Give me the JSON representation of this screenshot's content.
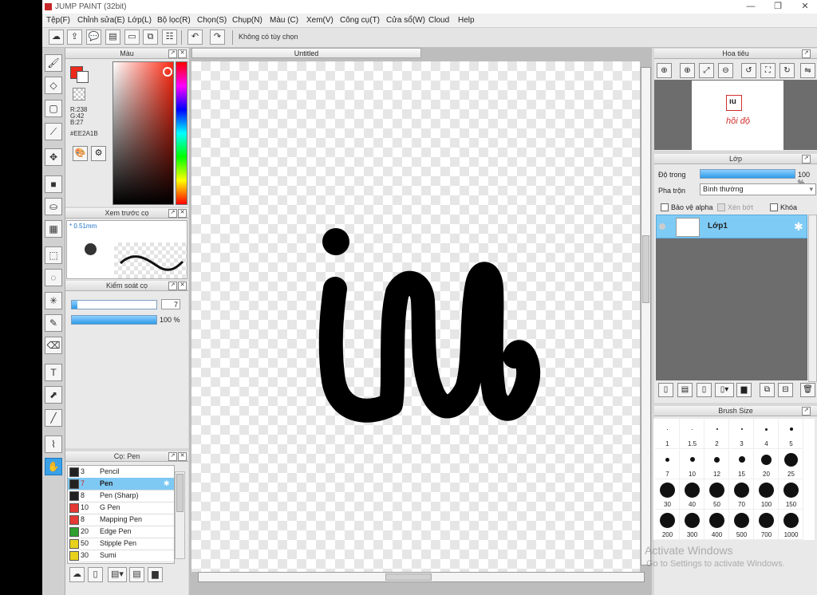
{
  "window": {
    "title": "JUMP PAINT (32bit)",
    "min": "—",
    "max": "❐",
    "close": "✕"
  },
  "menu": [
    "Tệp(F)",
    "Chỉnh sửa(E)",
    "Lớp(L)",
    "Bộ lọc(R)",
    "Chọn(S)",
    "Chụp(N)",
    "Màu (C)",
    "Xem(V)",
    "Công cụ(T)",
    "Cửa sổ(W)",
    "Cloud",
    "Help"
  ],
  "toolbar": {
    "options_text": "Không có tùy chọn"
  },
  "color_panel": {
    "title": "Màu",
    "r": "R:238",
    "g": "G:42",
    "b": "B:27",
    "hex": "#EE2A1B",
    "fg_color": "#ee2a1b"
  },
  "preview_panel": {
    "title": "Xem trước cọ",
    "size": "* 0.51mm"
  },
  "brush_control": {
    "title": "Kiểm soát cọ",
    "size_value": "7",
    "size_fraction": 0.07,
    "opacity_text": "100 %",
    "opacity_fraction": 1.0
  },
  "brush_panel": {
    "title": "Cọ: Pen",
    "items": [
      {
        "num": "3",
        "name": "Pencil",
        "color": "#222222"
      },
      {
        "num": "7",
        "name": "Pen",
        "color": "#222222"
      },
      {
        "num": "8",
        "name": "Pen (Sharp)",
        "color": "#222222"
      },
      {
        "num": "10",
        "name": "G Pen",
        "color": "#e53935"
      },
      {
        "num": "8",
        "name": "Mapping Pen",
        "color": "#e53935"
      },
      {
        "num": "20",
        "name": "Edge Pen",
        "color": "#2e9e2e"
      },
      {
        "num": "50",
        "name": "Stipple Pen",
        "color": "#e8d21c"
      },
      {
        "num": "30",
        "name": "Sumi",
        "color": "#e8d21c"
      }
    ]
  },
  "canvas": {
    "tab_title": "Untitled"
  },
  "navigator": {
    "title": "Hoa tiêu",
    "thumb_text": "hồi độ"
  },
  "layers": {
    "title": "Lớp",
    "opacity_label": "Độ trong",
    "opacity_text": "100 %",
    "opacity_fraction": 1.0,
    "blend_label": "Pha trộn",
    "blend_value": "Bình thường",
    "protect_alpha": "Bảo vệ alpha",
    "clipping": "Xén bớt",
    "lock": "Khóa",
    "layer_name": "Lớp1"
  },
  "brush_size": {
    "title": "Brush Size",
    "labels": [
      "1",
      "1.5",
      "2",
      "3",
      "4",
      "5",
      "7",
      "10",
      "12",
      "15",
      "20",
      "25",
      "30",
      "40",
      "50",
      "70",
      "100",
      "150",
      "200",
      "300",
      "400",
      "500",
      "700",
      "1000"
    ]
  },
  "watermark": {
    "line1": "Activate Windows",
    "line2": "Go to Settings to activate Windows."
  }
}
